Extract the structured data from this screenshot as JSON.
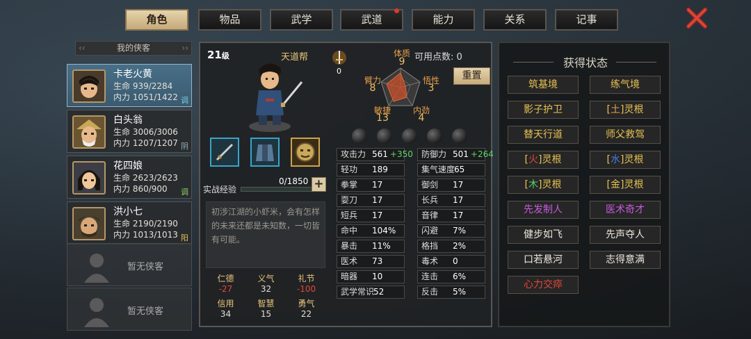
{
  "tabs": [
    {
      "label": "角色",
      "active": true
    },
    {
      "label": "物品"
    },
    {
      "label": "武学"
    },
    {
      "label": "武道",
      "badge": true
    },
    {
      "label": "能力"
    },
    {
      "label": "关系"
    },
    {
      "label": "记事"
    }
  ],
  "roster": {
    "header": "我的侠客",
    "members": [
      {
        "name": "卡老火黄",
        "hp": "生命 939/2284",
        "mp": "内力 1051/1422",
        "tag": "调",
        "selected": true
      },
      {
        "name": "白头翁",
        "hp": "生命 3006/3006",
        "mp": "内力 1207/1207",
        "tag": "阴"
      },
      {
        "name": "花四娘",
        "hp": "生命 2623/2623",
        "mp": "内力 860/900",
        "tag": "调"
      },
      {
        "name": "洪小七",
        "hp": "生命 2190/2190",
        "mp": "内力 1013/1013",
        "tag": "阳"
      }
    ],
    "empty_label_1": "暂无侠客",
    "empty_label_2": "暂无侠客"
  },
  "character": {
    "level_num": "21",
    "level_unit": "级",
    "sect": "天道帮",
    "weapon_count": "0",
    "points_label": "可用点数: 0",
    "reset_label": "重置",
    "exp_label": "实战经验",
    "exp_value": "0/1850",
    "exp_fraction": 0,
    "plus_label": "+",
    "bio": "初涉江湖的小虾米，会有怎样的未来还都是未知数，一切皆有可能。"
  },
  "attributes": {
    "tizhi": {
      "label": "体质",
      "value": "9"
    },
    "bili": {
      "label": "臂力",
      "value": "8"
    },
    "wuxing": {
      "label": "悟性",
      "value": "3"
    },
    "minjie": {
      "label": "敏捷",
      "value": "13"
    },
    "neijin": {
      "label": "内劲",
      "value": "4"
    }
  },
  "virtues": [
    {
      "label": "仁德",
      "value": "-27",
      "neg": true
    },
    {
      "label": "义气",
      "value": "32"
    },
    {
      "label": "礼节",
      "value": "-100",
      "neg": true
    },
    {
      "label": "信用",
      "value": "34"
    },
    {
      "label": "智慧",
      "value": "15"
    },
    {
      "label": "勇气",
      "value": "22"
    }
  ],
  "stats": {
    "left": [
      {
        "k": "攻击力",
        "v": "561",
        "add": "+350"
      },
      {
        "k": "轻功",
        "v": "189"
      },
      {
        "k": "拳掌",
        "v": "17"
      },
      {
        "k": "耍刀",
        "v": "17"
      },
      {
        "k": "短兵",
        "v": "17"
      },
      {
        "k": "命中",
        "v": "104%"
      },
      {
        "k": "暴击",
        "v": "11%"
      },
      {
        "k": "医术",
        "v": "73"
      },
      {
        "k": "暗器",
        "v": "10"
      },
      {
        "k": "武学常识",
        "v": "52"
      }
    ],
    "right": [
      {
        "k": "防御力",
        "v": "501",
        "add": "+264"
      },
      {
        "k": "集气速度",
        "v": "65"
      },
      {
        "k": "御剑",
        "v": "17"
      },
      {
        "k": "长兵",
        "v": "17"
      },
      {
        "k": "音律",
        "v": "17"
      },
      {
        "k": "闪避",
        "v": "7%"
      },
      {
        "k": "格挡",
        "v": "2%"
      },
      {
        "k": "毒术",
        "v": "0"
      },
      {
        "k": "连击",
        "v": "6%"
      },
      {
        "k": "反击",
        "v": "5%"
      }
    ]
  },
  "status": {
    "title": "获得状态",
    "items": [
      {
        "pre": "",
        "mid": "筑基境",
        "post": "",
        "cls": "gold"
      },
      {
        "pre": "",
        "mid": "练气境",
        "post": "",
        "cls": "gold"
      },
      {
        "pre": "",
        "mid": "影子护卫",
        "post": "",
        "cls": "gold"
      },
      {
        "pre": "[",
        "mid": "土",
        "post": "]灵根",
        "cls": "gold",
        "mcls": "b-orange"
      },
      {
        "pre": "",
        "mid": "替天行道",
        "post": "",
        "cls": "gold"
      },
      {
        "pre": "",
        "mid": "师父救驾",
        "post": "",
        "cls": "gold"
      },
      {
        "pre": "[",
        "mid": "火",
        "post": "]灵根",
        "cls": "gold",
        "mcls": "b-red"
      },
      {
        "pre": "[",
        "mid": "水",
        "post": "]灵根",
        "cls": "gold",
        "mcls": "b-blue"
      },
      {
        "pre": "[",
        "mid": "木",
        "post": "]灵根",
        "cls": "gold",
        "mcls": "b-green"
      },
      {
        "pre": "[",
        "mid": "金",
        "post": "]灵根",
        "cls": "gold",
        "mcls": "b-yellow"
      },
      {
        "pre": "",
        "mid": "先发制人",
        "post": "",
        "cls": "purple"
      },
      {
        "pre": "",
        "mid": "医术奇才",
        "post": "",
        "cls": "purple"
      },
      {
        "pre": "",
        "mid": "健步如飞",
        "post": "",
        "cls": ""
      },
      {
        "pre": "",
        "mid": "先声夺人",
        "post": "",
        "cls": ""
      },
      {
        "pre": "",
        "mid": "口若悬河",
        "post": "",
        "cls": ""
      },
      {
        "pre": "",
        "mid": "志得意满",
        "post": "",
        "cls": ""
      },
      {
        "pre": "",
        "mid": "心力交瘁",
        "post": "",
        "cls": "red"
      }
    ]
  },
  "colors": {
    "accent_gold": "#e8c252",
    "tab_active": "#d9c49a",
    "selected_card": "#456a82"
  }
}
